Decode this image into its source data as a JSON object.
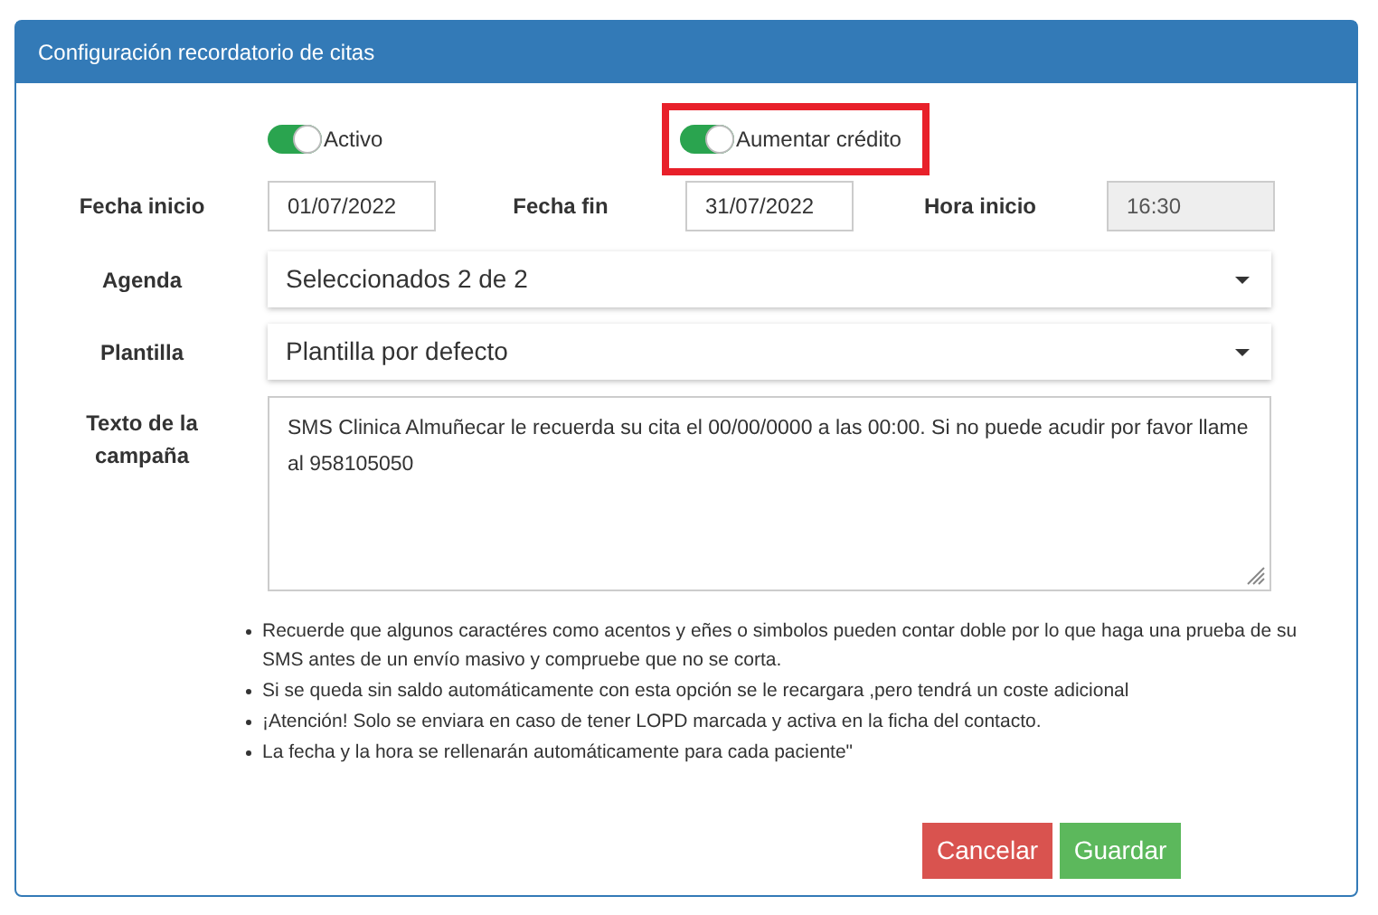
{
  "panel": {
    "title": "Configuración recordatorio de citas"
  },
  "toggles": [
    {
      "label": "Activo",
      "on": true,
      "highlighted": false
    },
    {
      "label": "Aumentar crédito",
      "on": true,
      "highlighted": true
    }
  ],
  "date_row": [
    {
      "label": "Fecha inicio",
      "value": "01/07/2022",
      "disabled": false
    },
    {
      "label": "Fecha fin",
      "value": "31/07/2022",
      "disabled": false
    },
    {
      "label": "Hora inicio",
      "value": "16:30",
      "disabled": true
    }
  ],
  "selects": [
    {
      "label": "Agenda",
      "value": "Seleccionados 2 de 2"
    },
    {
      "label": "Plantilla",
      "value": "Plantilla por defecto"
    }
  ],
  "campaign_text": {
    "label": "Texto de la campaña",
    "value": "SMS Clinica Almuñecar le recuerda su cita el 00/00/0000 a las 00:00. Si no puede acudir por favor llame al 958105050"
  },
  "notes": [
    "Recuerde que algunos caractéres como acentos y eñes o simbolos pueden contar doble por lo que haga una prueba de su SMS antes de un envío masivo y compruebe que no se corta.",
    "Si se queda sin saldo automáticamente con esta opción se le recargara ,pero tendrá un coste adicional",
    "¡Atención! Solo se enviara en caso de tener LOPD marcada y activa en la ficha del contacto.",
    "La fecha y la hora se rellenarán automáticamente para cada paciente\""
  ],
  "buttons": [
    {
      "label": "Cancelar",
      "kind": "danger"
    },
    {
      "label": "Guardar",
      "kind": "success"
    }
  ]
}
